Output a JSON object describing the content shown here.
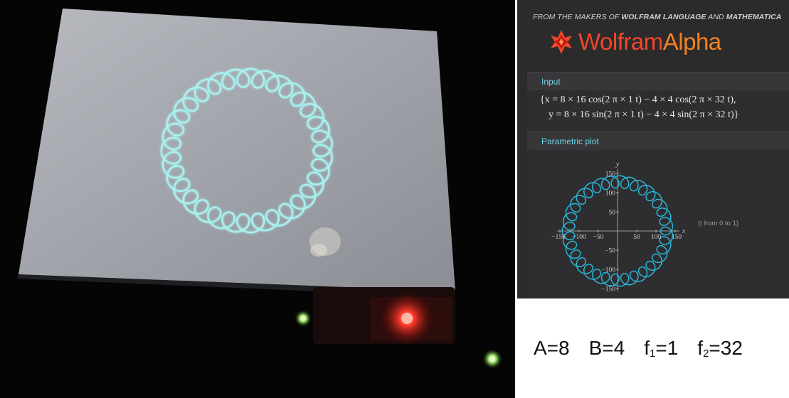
{
  "wolfram": {
    "tagline_prefix": "FROM THE MAKERS OF ",
    "tagline_wolfram": "WOLFRAM LANGUAGE",
    "tagline_and": " AND ",
    "tagline_mathematica": "MATHEMATICA",
    "logo_word_1": "Wolfram",
    "logo_word_2": "Alpha",
    "input_pod": {
      "title": "Input",
      "line1": "{x = 8 × 16 cos(2 π × 1 t) − 4 × 4 cos(2 π × 32 t),",
      "line2": "y = 8 × 16 sin(2 π × 1 t) − 4 × 4 sin(2 π × 32 t)}"
    },
    "plot_pod": {
      "title": "Parametric plot",
      "note": "(t from 0 to 1)"
    }
  },
  "chart_data": {
    "type": "line",
    "title": "",
    "xlabel": "x",
    "ylabel": "y",
    "xlim": [
      -150,
      150
    ],
    "ylim": [
      -150,
      150
    ],
    "x_ticks": [
      "−150",
      "−100",
      "−50",
      "50",
      "100",
      "150"
    ],
    "y_ticks": [
      "150",
      "100",
      "50",
      "−50",
      "−100",
      "−150"
    ],
    "curve": {
      "A": 8,
      "B": 4,
      "R1": 16,
      "R2": 4,
      "f1": 1,
      "f2": 32,
      "x": "A*R1*cos(2π f1 t) − B*R2*cos(2π f2 t)",
      "y": "A*R1*sin(2π f1 t) − B*R2*sin(2π f2 t)",
      "t_range": [
        0,
        1
      ],
      "color": "#2bb5d8"
    }
  },
  "params": {
    "A": "A=8",
    "B": "B=4",
    "f1_base": "f",
    "f1_sub": "1",
    "f1_val": "=1",
    "f2_base": "f",
    "f2_sub": "2",
    "f2_val": "=32"
  },
  "colors": {
    "photo_bg": "#050506",
    "screen": "#9ea1a8",
    "trace": "#a8f2f0",
    "wa_bg": "#2b2b2c",
    "pod_title": "#6fd3e6"
  }
}
